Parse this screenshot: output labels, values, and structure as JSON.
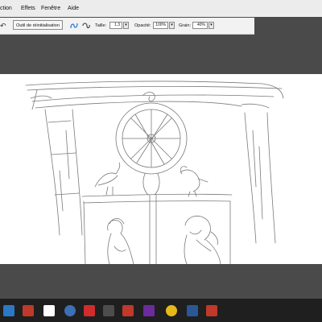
{
  "menu": {
    "items": [
      "ction",
      "Effets",
      "Fenêtre",
      "Aide"
    ]
  },
  "toolbar": {
    "reset_label": "Outil de réinitialisation",
    "size_label": "Taille:",
    "size_value": "1.3",
    "opacity_label": "Opacité:",
    "opacity_value": "100%",
    "grain_label": "Grain:",
    "grain_value": "40%"
  },
  "taskbar": {
    "icons": [
      "libreoffice-icon",
      "app-red-icon",
      "mail-icon",
      "app-blue-icon",
      "app-red-arrow-icon",
      "shield-icon",
      "yahoo-icon",
      "visual-studio-icon",
      "chrome-icon",
      "word-icon",
      "app-red2-icon"
    ]
  }
}
